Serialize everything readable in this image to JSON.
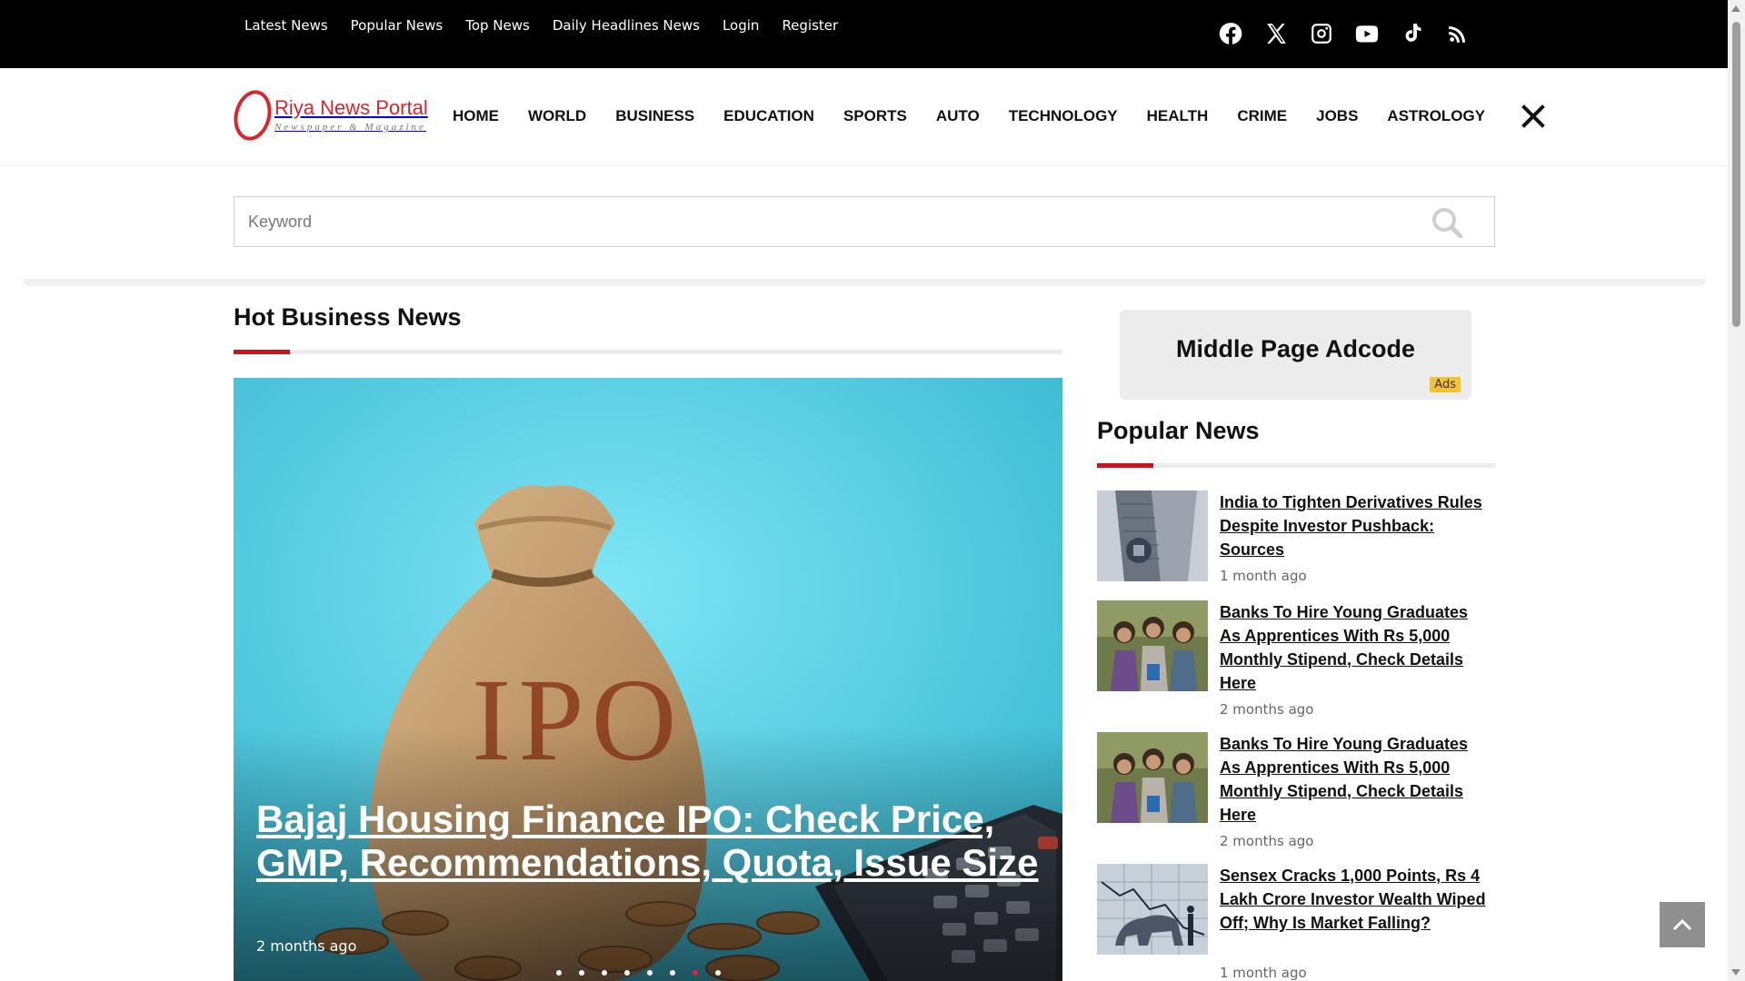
{
  "topbar": {
    "links": [
      "Latest News",
      "Popular News",
      "Top News",
      "Daily Headlines News",
      "Login",
      "Register"
    ],
    "social_icons": [
      "facebook-icon",
      "x-icon",
      "instagram-icon",
      "youtube-icon",
      "tiktok-icon",
      "rss-icon"
    ]
  },
  "brand": {
    "name": "Riya News Portal",
    "tagline": "Newspaper & Magazine",
    "color": "#d8262f"
  },
  "nav": {
    "items": [
      "HOME",
      "WORLD",
      "BUSINESS",
      "EDUCATION",
      "SPORTS",
      "AUTO",
      "TECHNOLOGY",
      "HEALTH",
      "CRIME",
      "JOBS",
      "ASTROLOGY"
    ],
    "close_icon": "close-icon"
  },
  "search": {
    "placeholder": "Keyword",
    "icon": "search-icon"
  },
  "hot_business": {
    "heading": "Hot Business News",
    "accent": "#c9141d",
    "slide": {
      "title": "Bajaj Housing Finance IPO: Check Price, GMP, Recommendations, Quota, Issue Size",
      "bag_text": "IPO",
      "time": "2 months ago"
    },
    "dot_count": 8,
    "active_dot": 6
  },
  "ad": {
    "text": "Middle Page Adcode",
    "badge": "Ads",
    "badge_color": "#f4c22b"
  },
  "popular": {
    "heading": "Popular News",
    "items": [
      {
        "title": "India to Tighten Derivatives Rules Despite Investor Pushback: Sources",
        "time": "1 month ago",
        "thumb": "sebi-building"
      },
      {
        "title": "Banks To Hire Young Graduates As Apprentices With Rs 5,000 Monthly Stipend, Check Details Here",
        "time": "2 months ago",
        "thumb": "students"
      },
      {
        "title": "Banks To Hire Young Graduates As Apprentices With Rs 5,000 Monthly Stipend, Check Details Here",
        "time": "2 months ago",
        "thumb": "students"
      },
      {
        "title": "Sensex Cracks 1,000 Points, Rs 4 Lakh Crore Investor Wealth Wiped Off; Why Is Market Falling?",
        "time": "1 month ago",
        "thumb": "bear-market"
      }
    ]
  },
  "scroll_top_icon": "chevron-up-icon"
}
